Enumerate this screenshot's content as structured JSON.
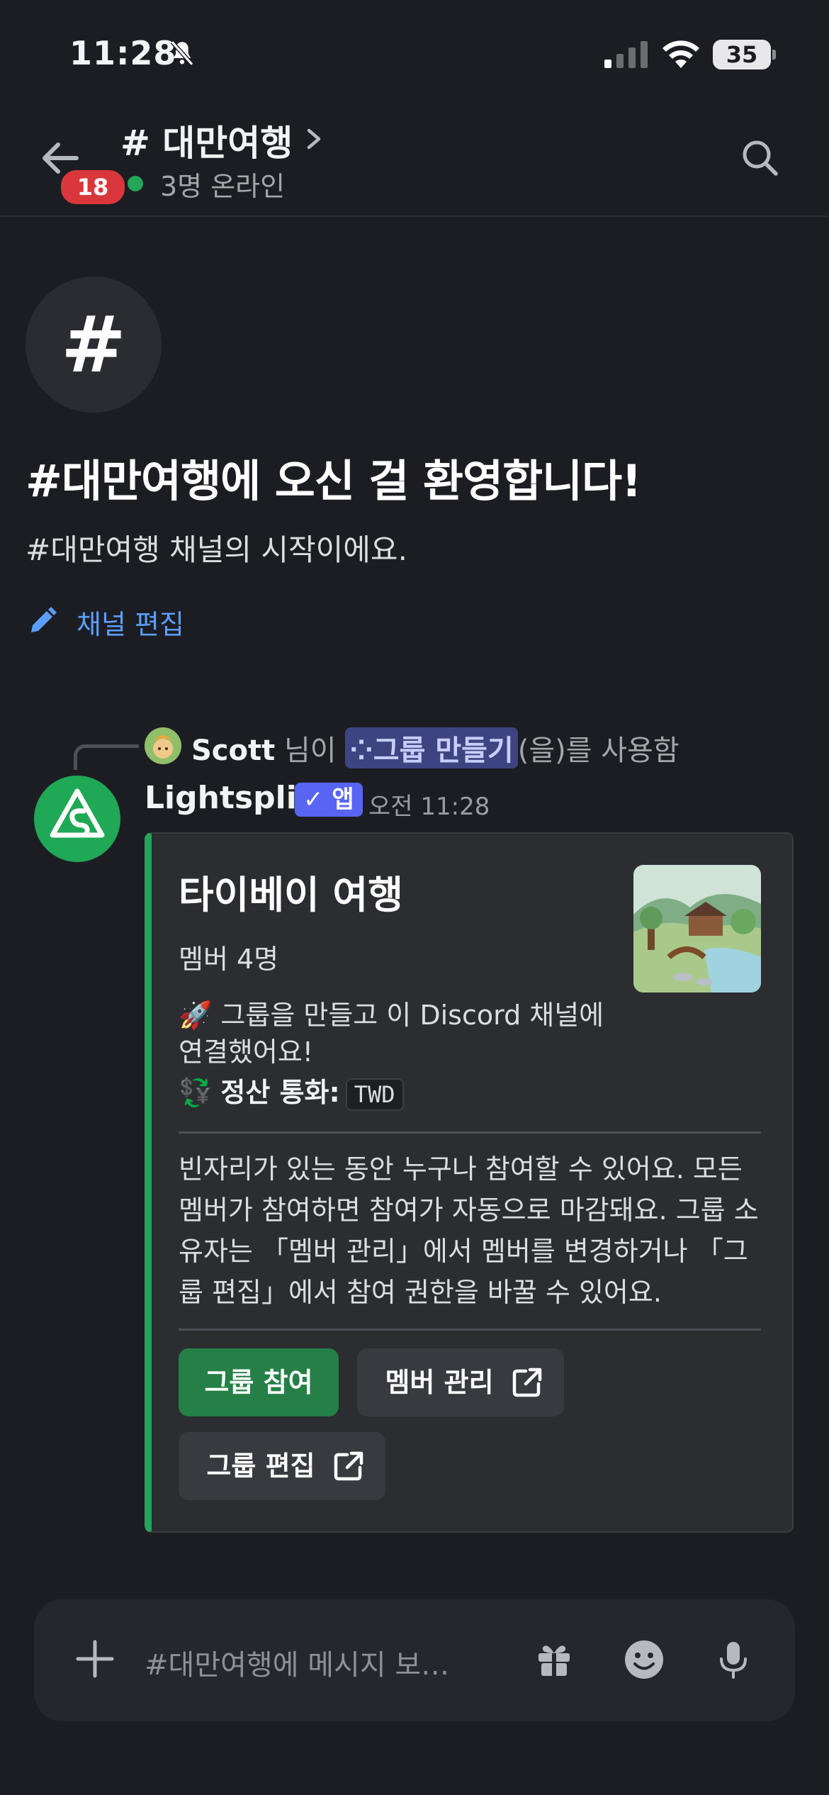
{
  "status_bar": {
    "time": "11:28",
    "battery": "35"
  },
  "header": {
    "unread_badge": "18",
    "channel_title": "# 대만여행",
    "online_text": "3명 온라인"
  },
  "welcome": {
    "hash_symbol": "#",
    "title": "#대만여행에 오신 걸 환영합니다!",
    "subtitle": "#대만여행 채널의 시작이에요.",
    "edit_link": "채널 편집"
  },
  "interaction": {
    "user": "Scott",
    "suffix1": " 님이 ",
    "command": "그룹 만들기",
    "suffix2": "(을)를 사용함"
  },
  "message": {
    "author": "Lightsplit",
    "app_tag": "✓ 앱",
    "timestamp": "오전 11:28",
    "embed": {
      "title": "타이베이 여행",
      "members": "멤버 4명",
      "created_text": "🚀 그룹을 만들고 이 Discord 채널에 연결했어요!",
      "currency_label": "정산 통화:",
      "currency_value": "TWD",
      "description": "빈자리가 있는 동안 누구나 참여할 수 있어요. 모든 멤버가 참여하면 참여가 자동으로 마감돼요. 그룹 소유자는 「멤버 관리」에서 멤버를 변경하거나 「그룹 편집」에서 참여 권한을 바꿀 수 있어요."
    },
    "buttons": {
      "join": "그룹 참여",
      "manage_members": "멤버 관리",
      "edit_group": "그룹 편집"
    }
  },
  "composer": {
    "placeholder": "#대만여행에 메시지 보…"
  },
  "colors": {
    "accent_green": "#23a55a",
    "blurple": "#5865f2",
    "link_blue": "#5b9dfa",
    "badge_red": "#da373c"
  }
}
